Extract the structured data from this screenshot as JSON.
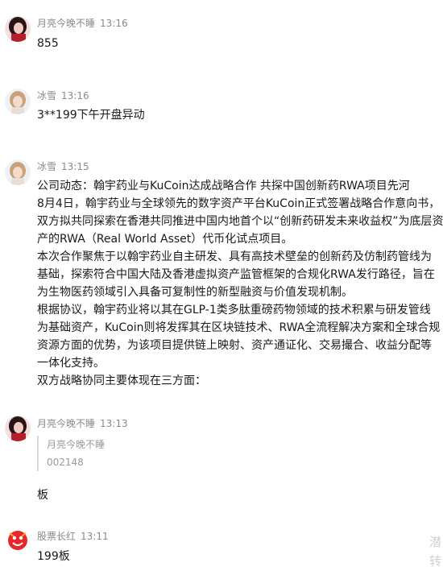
{
  "messages": [
    {
      "name": "月亮今晚不睡",
      "time": "13:16",
      "text": "855"
    },
    {
      "name": "冰雪",
      "time": "13:16",
      "text": "3**199下午开盘异动"
    },
    {
      "name": "冰雪",
      "time": "13:15",
      "lines": [
        "公司动态：翰宇药业与KuCoin达成战略合作 共探中国创新药RWA项目先河",
        "8月4日，翰宇药业与全球领先的数字资产平台KuCoin正式签署战略合作意向书，",
        "双方拟共同探索在香港共同推进中国内地首个以“创新药研发未来收益权”为底层资",
        "产的RWA（Real World Asset）代币化试点项目。",
        "本次合作聚焦于以翰宇药业自主研发、具有高技术壁垒的创新药及仿制药管线为",
        "基础，探索符合中国大陆及香港虚拟资产监管框架的合规化RWA发行路径，旨在",
        "为生物医药领域引入具备可复制性的新型融资与价值发现机制。",
        "根据协议，翰宇药业将以其在GLP-1类多肽重磅药物领域的技术积累与研发管线",
        "为基础资产，KuCoin则将发挥其在区块链技术、RWA全流程解决方案和全球合规",
        "资源方面的优势，为该项目提供链上映射、资产通证化、交易撮合、收益分配等",
        "一体化支持。",
        "双方战略协同主要体现在三方面："
      ]
    },
    {
      "name": "月亮今晚不睡",
      "time": "13:13",
      "quote_name": "月亮今晚不睡",
      "quote_text": "002148",
      "text": "板"
    },
    {
      "name": "股票长红",
      "time": "13:11",
      "text": "199板"
    }
  ],
  "edge_watermark": [
    "潜",
    "转"
  ]
}
